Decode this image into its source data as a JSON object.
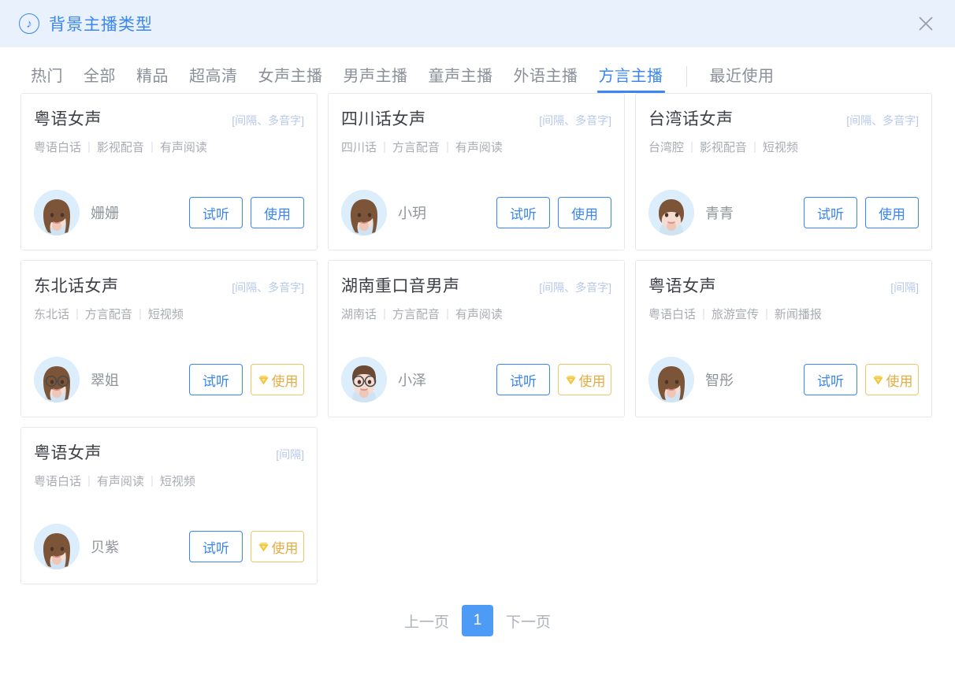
{
  "header": {
    "icon": "music-note-icon",
    "title": "背景主播类型",
    "close_label": "×",
    "accent_color": "#3b86f0",
    "background_color": "#e9f1fd"
  },
  "tabs": {
    "items": [
      {
        "label": "热门",
        "active": false
      },
      {
        "label": "全部",
        "active": false
      },
      {
        "label": "精品",
        "active": false
      },
      {
        "label": "超高清",
        "active": false
      },
      {
        "label": "女声主播",
        "active": false
      },
      {
        "label": "男声主播",
        "active": false
      },
      {
        "label": "童声主播",
        "active": false
      },
      {
        "label": "外语主播",
        "active": false
      },
      {
        "label": "方言主播",
        "active": true
      }
    ],
    "recent_label": "最近使用"
  },
  "buttons": {
    "preview_label": "试听",
    "use_label": "使用",
    "vip_icon": "vip-diamond-icon",
    "vip_color": "#e2ad45"
  },
  "cards": [
    {
      "title": "粤语女声",
      "feature": "[间隔、多音字]",
      "tags": [
        "粤语白话",
        "影视配音",
        "有声阅读"
      ],
      "speaker": "姗姗",
      "avatar": "female-long-brown-hair",
      "vip": false
    },
    {
      "title": "四川话女声",
      "feature": "[间隔、多音字]",
      "tags": [
        "四川话",
        "方言配音",
        "有声阅读"
      ],
      "speaker": "小玥",
      "avatar": "female-long-brown-hair",
      "vip": false
    },
    {
      "title": "台湾话女声",
      "feature": "[间隔、多音字]",
      "tags": [
        "台湾腔",
        "影视配音",
        "短视频"
      ],
      "speaker": "青青",
      "avatar": "female-short-brown-hair",
      "vip": false
    },
    {
      "title": "东北话女声",
      "feature": "[间隔、多音字]",
      "tags": [
        "东北话",
        "方言配音",
        "短视频"
      ],
      "speaker": "翠姐",
      "avatar": "female-glasses",
      "vip": true
    },
    {
      "title": "湖南重口音男声",
      "feature": "[间隔、多音字]",
      "tags": [
        "湖南话",
        "方言配音",
        "有声阅读"
      ],
      "speaker": "小泽",
      "avatar": "male-glasses",
      "vip": true
    },
    {
      "title": "粤语女声",
      "feature": "[间隔]",
      "tags": [
        "粤语白话",
        "旅游宣传",
        "新闻播报"
      ],
      "speaker": "智彤",
      "avatar": "female-long-brown-hair",
      "vip": true
    },
    {
      "title": "粤语女声",
      "feature": "[间隔]",
      "tags": [
        "粤语白话",
        "有声阅读",
        "短视频"
      ],
      "speaker": "贝紫",
      "avatar": "female-long-brown-hair",
      "vip": true
    }
  ],
  "pagination": {
    "prev_label": "上一页",
    "current_page": "1",
    "next_label": "下一页"
  }
}
